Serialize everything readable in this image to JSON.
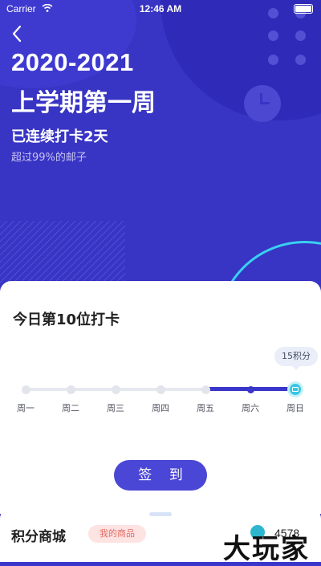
{
  "status_bar": {
    "carrier": "Carrier",
    "time": "12:46 AM"
  },
  "header": {
    "term": "2020-2021",
    "week": "上学期第一周",
    "streak": "已连续打卡2天",
    "rank": "超过99%的邮子"
  },
  "checkin": {
    "title": "今日第10位打卡",
    "reward_tip": "15积分",
    "days": [
      "周一",
      "周二",
      "周三",
      "周四",
      "周五",
      "周六",
      "周日"
    ],
    "completed_days": [
      "周五",
      "周六",
      "周日"
    ],
    "button_label": "签 到"
  },
  "shop": {
    "title": "积分商城",
    "my_goods_label": "我的商品",
    "points": "4578"
  },
  "watermark": "大玩家",
  "colors": {
    "primary": "#3a36c9",
    "accent": "#39c6e4",
    "tag_bg": "#fde3e2"
  }
}
